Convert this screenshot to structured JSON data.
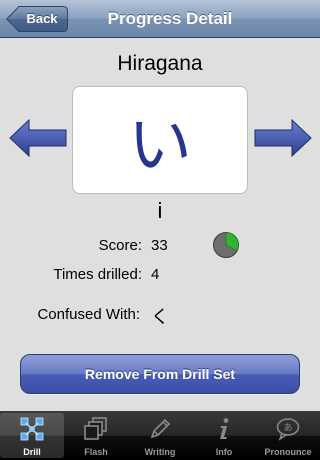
{
  "navbar": {
    "title": "Progress Detail",
    "back_label": "Back"
  },
  "detail": {
    "script_name": "Hiragana",
    "character": "い",
    "romaji": "i",
    "score_label": "Score:",
    "score_value": "33",
    "score_fraction": 0.33,
    "times_label": "Times drilled:",
    "times_value": "4",
    "confused_label": "Confused With:",
    "confused_value": "く"
  },
  "actions": {
    "remove_label": "Remove From Drill Set"
  },
  "tabbar": {
    "selected": "Drill",
    "tabs": [
      {
        "label": "Drill",
        "icon": "drill-icon"
      },
      {
        "label": "Flash",
        "icon": "flash-cards-icon"
      },
      {
        "label": "Writing",
        "icon": "pencil-icon"
      },
      {
        "label": "Info",
        "icon": "info-icon"
      },
      {
        "label": "Pronounce",
        "icon": "speech-bubble-icon"
      }
    ]
  },
  "colors": {
    "navbar": "#7b94b5",
    "arrow": "#3a4fa0",
    "glyph": "#24368f",
    "pie_fill": "#2fb52f",
    "button": "#4a5db6"
  }
}
